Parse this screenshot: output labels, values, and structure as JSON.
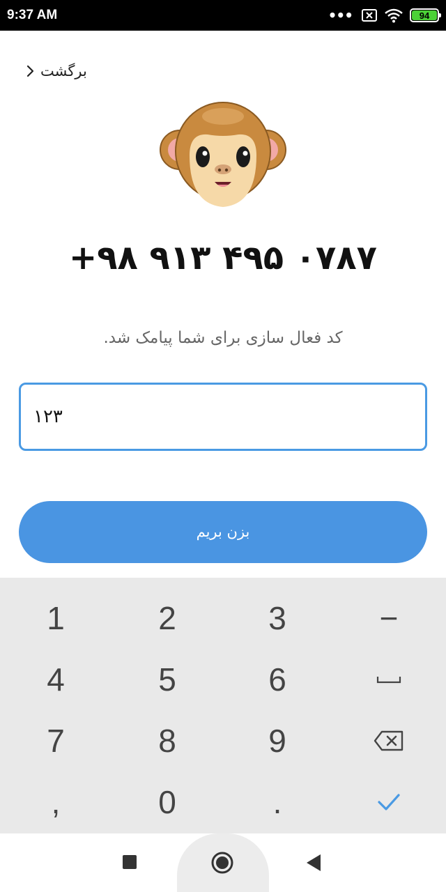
{
  "status_bar": {
    "time": "9:37 AM",
    "dots": "•••",
    "battery": "94",
    "icons": [
      "more-dots-icon",
      "x-box-icon",
      "wifi-icon",
      "battery-icon"
    ]
  },
  "header": {
    "back_label": "برگشت",
    "back_icon": "chevron-right-icon"
  },
  "avatar": {
    "icon": "monkey-face-icon"
  },
  "phone_number": "+۹۸ ۹۱۳ ۴۹۵ ۰۷۸۷",
  "sms_hint": "کد فعال سازی برای شما پیامک شد.",
  "code_input": {
    "value": "۱۲۳"
  },
  "submit_button": {
    "label": "بزن بریم",
    "color": "#4a95e2"
  },
  "accent_color": "#4a9ae3",
  "keyboard": {
    "keys": {
      "k1": "1",
      "k2": "2",
      "k3": "3",
      "dash": "−",
      "k4": "4",
      "k5": "5",
      "k6": "6",
      "k7": "7",
      "k8": "8",
      "k9": "9",
      "comma": ",",
      "k0": "0",
      "dot": "."
    },
    "icons": [
      "space-icon",
      "backspace-icon",
      "check-icon"
    ]
  },
  "nav_bar": {
    "icons": [
      "recents-square-icon",
      "home-circle-icon",
      "back-triangle-icon"
    ]
  }
}
